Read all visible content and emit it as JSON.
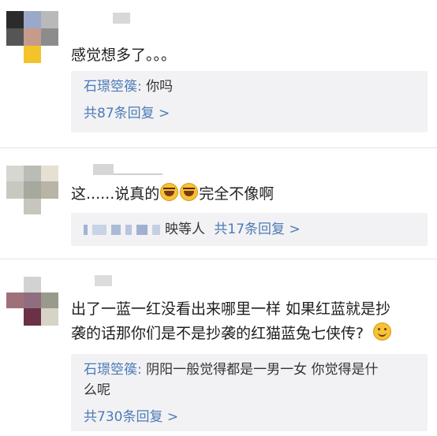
{
  "comments": [
    {
      "text": "感觉想多了。。。",
      "reply": {
        "author": "石璟箜篌:",
        "content": "你吗",
        "more": "共87条回复 >"
      }
    },
    {
      "text_a": "这......说真的",
      "emoji": "laughing-crying-emoji",
      "text_b": "完全不像啊",
      "reply": {
        "author_suffix": "映等人",
        "more": "共17条回复 >"
      }
    },
    {
      "line1": "出了一蓝一红没看出来哪里一样 如果红蓝就是抄",
      "line2": "袭的话那你们是不是抄袭的红猫蓝兔七侠传?",
      "emoji": "smile-emoji",
      "reply": {
        "author": "石璟箜篌:",
        "content1": "阴阳一般觉得都是一男一女 你觉得是什",
        "content2": "么呢",
        "more": "共730条回复 >"
      }
    }
  ],
  "colors": {
    "link": "#4d7bb6",
    "reply_bg": "#f2f2f4",
    "emoji": "#f6c236"
  }
}
